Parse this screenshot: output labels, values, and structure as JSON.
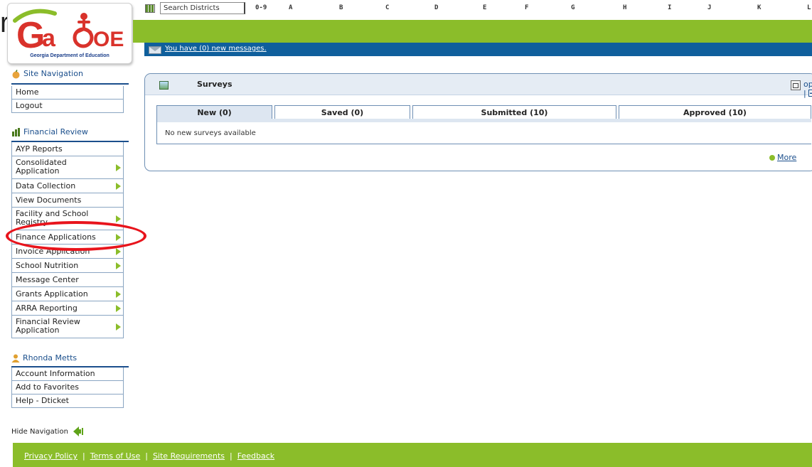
{
  "logo": {
    "fragment": "r",
    "brand": "GaDOE",
    "tagline": "Georgia Department of Education"
  },
  "topbar": {
    "search_value": "Search Districts",
    "letters": [
      "0-9",
      "A",
      "B",
      "C",
      "D",
      "E",
      "F",
      "G",
      "H",
      "I",
      "J",
      "K",
      "L"
    ]
  },
  "messages": {
    "text": "You have (0) new messages."
  },
  "sidebar": {
    "site_nav": {
      "heading": "Site Navigation",
      "items": [
        {
          "label": "Home"
        },
        {
          "label": "Logout"
        }
      ]
    },
    "financial": {
      "heading": "Financial Review",
      "items": [
        {
          "label": "AYP Reports",
          "submenu": false
        },
        {
          "label": "Consolidated Application",
          "submenu": true
        },
        {
          "label": "Data Collection",
          "submenu": true
        },
        {
          "label": "View Documents",
          "submenu": false
        },
        {
          "label": "Facility and School Registry",
          "submenu": true
        },
        {
          "label": "Finance Applications",
          "submenu": true
        },
        {
          "label": "Invoice Application",
          "submenu": true
        },
        {
          "label": "School Nutrition",
          "submenu": true
        },
        {
          "label": "Message Center",
          "submenu": false
        },
        {
          "label": "Grants Application",
          "submenu": true
        },
        {
          "label": "ARRA Reporting",
          "submenu": true
        },
        {
          "label": "Financial Review Application",
          "submenu": true
        }
      ]
    },
    "user": {
      "heading": "Rhonda Metts",
      "items": [
        {
          "label": "Account Information"
        },
        {
          "label": "Add to Favorites"
        },
        {
          "label": "Help - Dticket"
        }
      ]
    },
    "hide_nav": "Hide Navigation"
  },
  "panel": {
    "title": "Surveys",
    "options": "options |",
    "tabs": [
      {
        "label": "New (0)",
        "active": true
      },
      {
        "label": "Saved (0)",
        "active": false
      },
      {
        "label": "Submitted (10)",
        "active": false
      },
      {
        "label": "Approved (10)",
        "active": false
      }
    ],
    "empty_text": "No new surveys available",
    "more": "More"
  },
  "footer": {
    "links": [
      "Privacy Policy",
      "Terms of Use",
      "Site Requirements",
      "Feedback"
    ]
  },
  "colors": {
    "accent_green": "#8bbd2a",
    "nav_blue": "#1b4f8c",
    "message_bar": "#0f5f9c",
    "highlight": "#e8141c"
  }
}
